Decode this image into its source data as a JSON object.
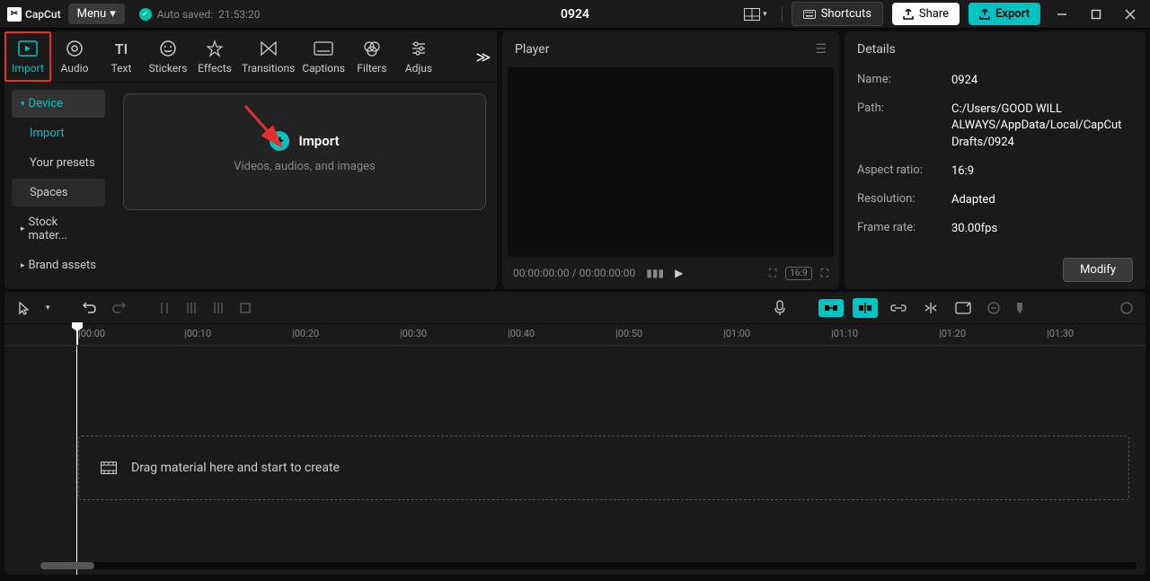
{
  "app": {
    "name": "CapCut",
    "menu_label": "Menu",
    "autosave_prefix": "Auto saved:",
    "autosave_time": "21:53:20",
    "project_title": "0924"
  },
  "topbar": {
    "shortcuts": "Shortcuts",
    "share": "Share",
    "export": "Export"
  },
  "media_tabs": [
    {
      "label": "Import"
    },
    {
      "label": "Audio"
    },
    {
      "label": "Text"
    },
    {
      "label": "Stickers"
    },
    {
      "label": "Effects"
    },
    {
      "label": "Transitions"
    },
    {
      "label": "Captions"
    },
    {
      "label": "Filters"
    },
    {
      "label": "Adjus"
    }
  ],
  "sidebar": {
    "device": "Device",
    "import": "Import",
    "presets": "Your presets",
    "spaces": "Spaces",
    "stock": "Stock mater...",
    "brand": "Brand assets"
  },
  "import_box": {
    "title": "Import",
    "hint": "Videos, audios, and images"
  },
  "player": {
    "title": "Player",
    "time_current": "00:00:00:00",
    "time_total": "00:00:00:00",
    "ratio": "16:9"
  },
  "details": {
    "title": "Details",
    "rows": [
      {
        "label": "Name:",
        "value": "0924"
      },
      {
        "label": "Path:",
        "value": "C:/Users/GOOD WILL ALWAYS/AppData/Local/CapCut Drafts/0924"
      },
      {
        "label": "Aspect ratio:",
        "value": "16:9"
      },
      {
        "label": "Resolution:",
        "value": "Adapted"
      },
      {
        "label": "Frame rate:",
        "value": "30.00fps"
      }
    ],
    "modify": "Modify"
  },
  "timeline": {
    "ticks": [
      "00:00",
      "00:10",
      "00:20",
      "00:30",
      "00:40",
      "00:50",
      "01:00",
      "01:10",
      "01:20",
      "01:30"
    ],
    "drop_hint": "Drag material here and start to create"
  }
}
